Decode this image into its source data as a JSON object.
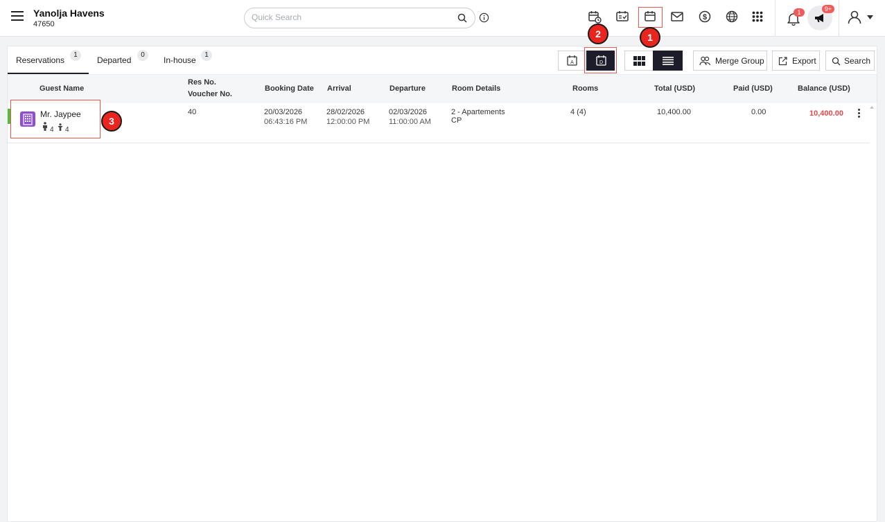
{
  "header": {
    "hotel_name": "Yanolja Havens",
    "hotel_id": "47650",
    "search_placeholder": "Quick Search",
    "notification_count": "1",
    "announcement_count": "9+"
  },
  "callouts": [
    "1",
    "2",
    "3"
  ],
  "tabs": [
    {
      "label": "Reservations",
      "count": "1"
    },
    {
      "label": "Departed",
      "count": "0"
    },
    {
      "label": "In-house",
      "count": "1"
    }
  ],
  "toolbar": {
    "merge_group": "Merge Group",
    "export": "Export",
    "search": "Search"
  },
  "table": {
    "columns": {
      "guest_name": "Guest Name",
      "res_no": "Res No.",
      "voucher_no": "Voucher No.",
      "booking_date": "Booking Date",
      "arrival": "Arrival",
      "departure": "Departure",
      "room_details": "Room Details",
      "rooms": "Rooms",
      "total": "Total (USD)",
      "paid": "Paid (USD)",
      "balance": "Balance (USD)"
    },
    "rows": [
      {
        "guest_name": "Mr. Jaypee",
        "adults": "4",
        "children": "4",
        "res_no": "40",
        "booking_date": "20/03/2026",
        "booking_time": "06:43:16 PM",
        "arrival_date": "28/02/2026",
        "arrival_time": "12:00:00 PM",
        "departure_date": "02/03/2026",
        "departure_time": "11:00:00 AM",
        "room_details": "2 - Apartements",
        "rate_plan": "CP",
        "rooms": "4 (4)",
        "total": "10,400.00",
        "paid": "0.00",
        "balance": "10,400.00"
      }
    ]
  },
  "colors": {
    "accent_dark": "#1c1c2a",
    "highlight_red": "#e8251e",
    "balance_red": "#e8474a",
    "status_green": "#4fbf3b",
    "room_icon_purple": "#8e4fd1"
  }
}
